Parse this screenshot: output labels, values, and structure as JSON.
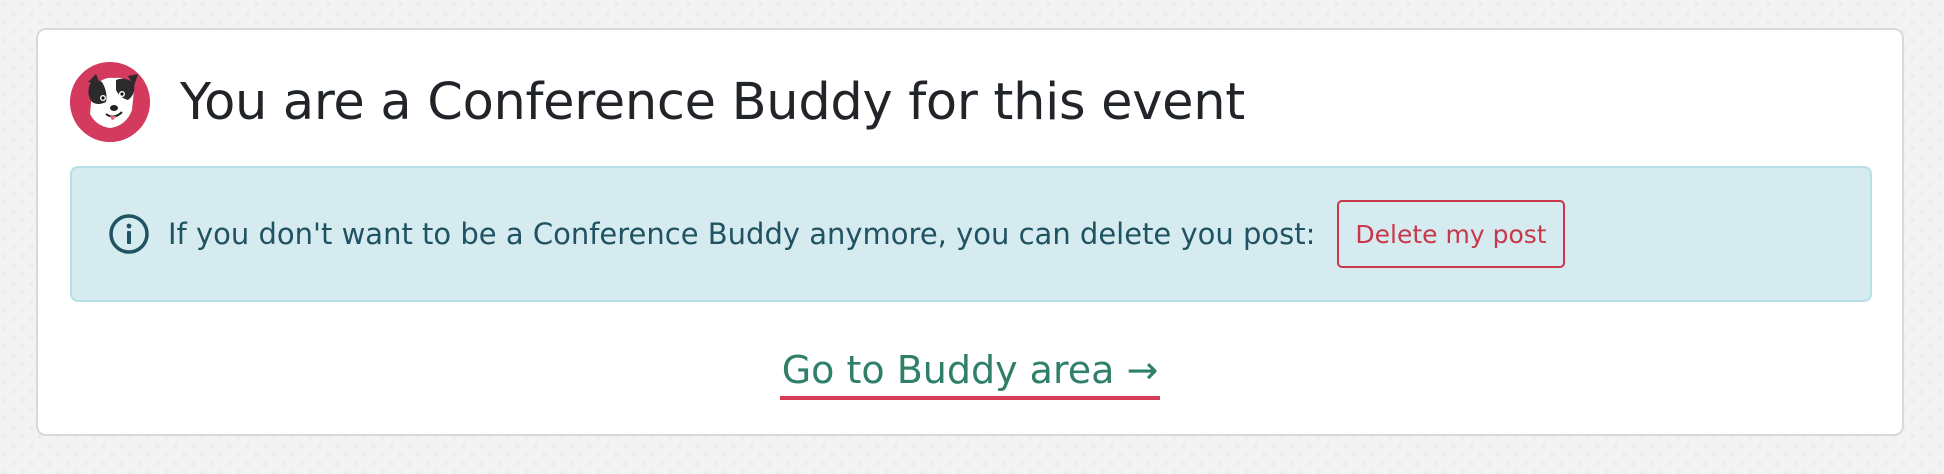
{
  "header": {
    "avatar_icon": "dog-avatar-icon",
    "title": "You are a Conference Buddy for this event"
  },
  "alert": {
    "icon": "info-icon",
    "message": "If you don't want to be a Conference Buddy anymore, you can delete you post:",
    "delete_label": "Delete my post"
  },
  "link": {
    "label": "Go to Buddy area →"
  },
  "colors": {
    "avatar_bg": "#d33a5d",
    "alert_bg": "#d5ebf0",
    "alert_text": "#1f5362",
    "danger": "#c9384a",
    "link": "#2f7f6a",
    "link_underline": "#d43b54"
  }
}
